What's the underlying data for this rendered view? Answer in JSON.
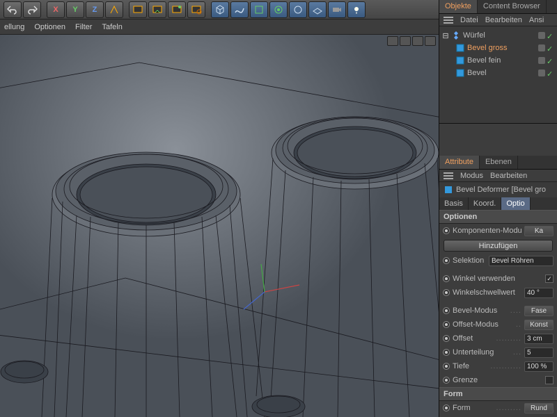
{
  "toolbar": {
    "axis_x": "X",
    "axis_y": "Y",
    "axis_z": "Z"
  },
  "menubar": {
    "m0": "ellung",
    "m1": "Optionen",
    "m2": "Filter",
    "m3": "Tafeln"
  },
  "objects_panel": {
    "tab_objects": "Objekte",
    "tab_content": "Content Browser",
    "menu_file": "Datei",
    "menu_edit": "Bearbeiten",
    "menu_view": "Ansi",
    "tree": {
      "root": "Würfel",
      "items": [
        {
          "label": "Bevel gross",
          "selected": true
        },
        {
          "label": "Bevel fein",
          "selected": false
        },
        {
          "label": "Bevel",
          "selected": false
        }
      ]
    }
  },
  "attributes_panel": {
    "tab_attr": "Attribute",
    "tab_layers": "Ebenen",
    "menu_mode": "Modus",
    "menu_edit": "Bearbeiten",
    "title": "Bevel Deformer [Bevel gro",
    "tabs": {
      "basis": "Basis",
      "koord": "Koord.",
      "option": "Optio"
    },
    "group_options": "Optionen",
    "komponenten_modus": "Komponenten-Modus",
    "komponenten_modus_val": "Ka",
    "add_btn": "Hinzufügen",
    "selection": "Selektion",
    "selection_val": "Bevel Röhren",
    "use_angle": "Winkel verwenden",
    "angle_threshold": "Winkelschwellwert",
    "angle_threshold_val": "40 °",
    "bevel_mode": "Bevel-Modus",
    "bevel_mode_val": "Fase",
    "offset_mode": "Offset-Modus",
    "offset_mode_val": "Konst",
    "offset": "Offset",
    "offset_val": "3 cm",
    "subdivision": "Unterteilung",
    "subdivision_val": "5",
    "depth": "Tiefe",
    "depth_val": "100 %",
    "limit": "Grenze",
    "group_form": "Form",
    "form": "Form",
    "form_val": "Rund"
  }
}
